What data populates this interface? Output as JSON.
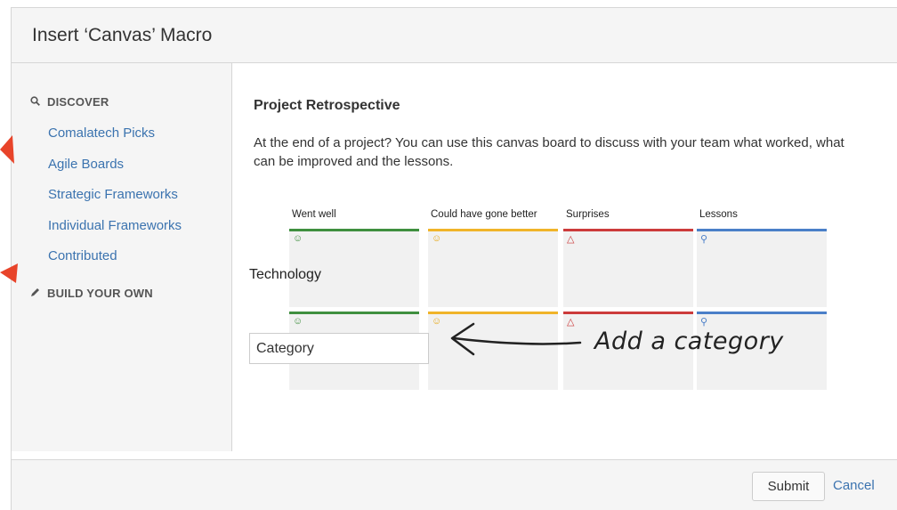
{
  "dialog": {
    "title": "Insert ‘Canvas’ Macro"
  },
  "sidebar": {
    "discover_heading": "DISCOVER",
    "discover_icon": "search-icon",
    "items": [
      {
        "label": "Comalatech Picks"
      },
      {
        "label": "Agile Boards"
      },
      {
        "label": "Strategic Frameworks"
      },
      {
        "label": "Individual Frameworks"
      },
      {
        "label": "Contributed"
      }
    ],
    "build_heading": "BUILD YOUR OWN",
    "build_icon": "pencil-icon"
  },
  "template": {
    "title": "Project Retrospective",
    "description": "At the end of a project? You can use this canvas board to discuss with your team what worked, what can be improved and the lessons."
  },
  "board": {
    "columns": [
      {
        "label": "Went well",
        "icon": "smiley-icon",
        "color": "#3f8f3f"
      },
      {
        "label": "Could have gone better",
        "icon": "neutral-face-icon",
        "color": "#f0b429"
      },
      {
        "label": "Surprises",
        "icon": "bell-icon",
        "color": "#cc3b3b"
      },
      {
        "label": "Lessons",
        "icon": "lightbulb-icon",
        "color": "#4a7fc8"
      }
    ],
    "row_label": "Technology",
    "category_input_value": "Category"
  },
  "annotation": {
    "text": "Add a category",
    "arrow_color": "#e8442a"
  },
  "footer": {
    "submit_label": "Submit",
    "cancel_label": "Cancel"
  }
}
